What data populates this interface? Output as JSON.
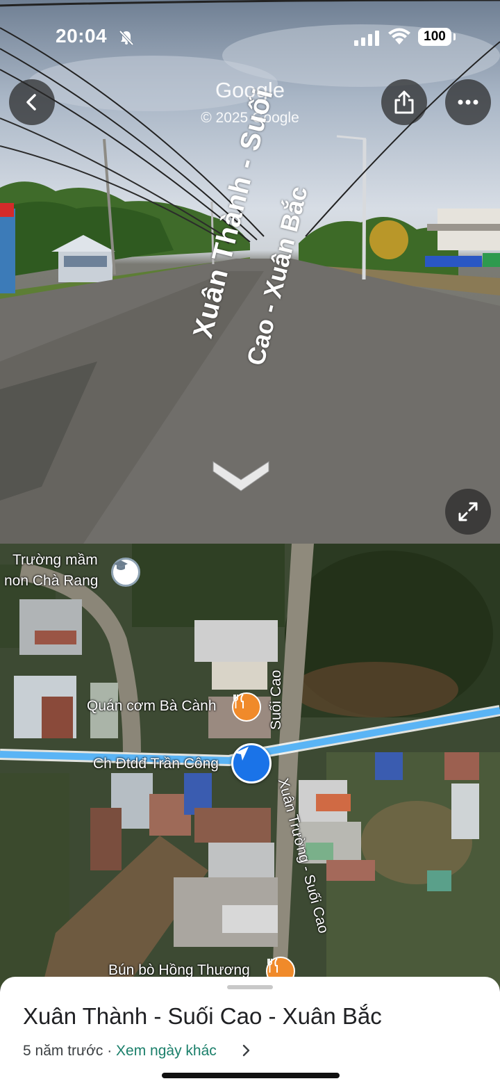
{
  "status_bar": {
    "time": "20:04",
    "battery": "100"
  },
  "street_view": {
    "google_logo": "Google",
    "copyright": "© 2025 Google",
    "road_label_line1": "Xuân Thành - Suối",
    "road_label_line2": "Cao - Xuân Bắc",
    "icons": [
      "back-icon",
      "share-icon",
      "more-icon",
      "chevron-down-icon",
      "expand-icon"
    ]
  },
  "map": {
    "labels": {
      "school_line1": "Trường mầm",
      "school_line2": "non Chà Rang",
      "restaurant1": "Quán cơm Bà Cành",
      "store": "Ch Đtdđ Trần Công",
      "street1": "Suối Cao",
      "street2": "Xuân Trường - Suối Cao",
      "restaurant2": "Bún bò Hồng Thương"
    }
  },
  "sheet": {
    "title": "Xuân Thành - Suối Cao - Xuân Bắc",
    "age": "5 năm trước",
    "separator": " · ",
    "other_dates_link": "Xem ngày khác"
  }
}
